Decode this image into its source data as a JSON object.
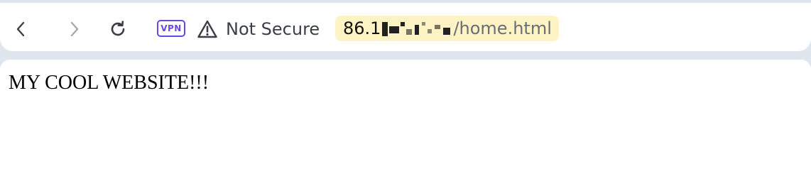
{
  "browser": {
    "nav": {
      "back_icon": "chevron-left-icon",
      "forward_icon": "chevron-right-icon",
      "reload_icon": "reload-icon"
    },
    "vpn_label": "VPN",
    "security_icon": "warning-triangle-icon",
    "security_text": "Not Secure",
    "url": {
      "host_visible": "86.1",
      "path": "/home.html"
    },
    "colors": {
      "vpn_accent": "#6b46e3",
      "url_highlight": "#fdf3c4",
      "frame": "#dfe6ee"
    }
  },
  "page": {
    "heading": "MY COOL WEBSITE!!!"
  }
}
